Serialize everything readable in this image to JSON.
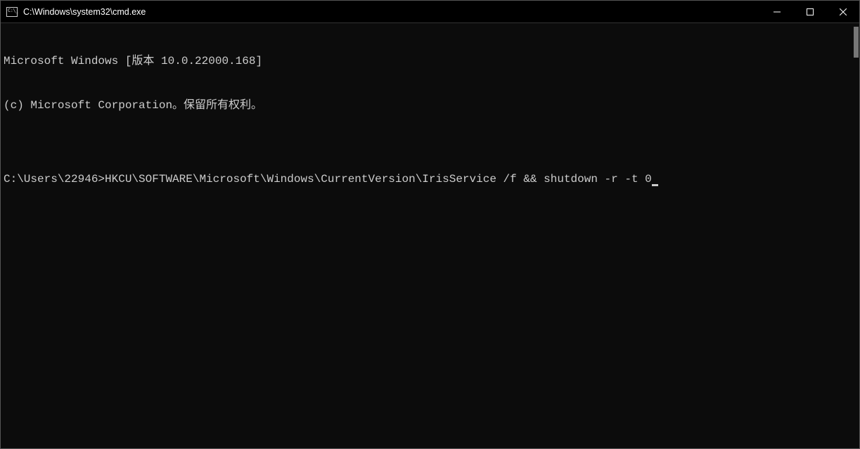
{
  "titlebar": {
    "title": "C:\\Windows\\system32\\cmd.exe"
  },
  "terminal": {
    "banner_line1": "Microsoft Windows [版本 10.0.22000.168]",
    "banner_line2": "(c) Microsoft Corporation。保留所有权利。",
    "blank_line": "",
    "prompt": "C:\\Users\\22946>",
    "command": "HKCU\\SOFTWARE\\Microsoft\\Windows\\CurrentVersion\\IrisService /f && shutdown -r -t 0"
  },
  "controls": {
    "minimize": "minimize",
    "maximize": "maximize",
    "close": "close"
  }
}
